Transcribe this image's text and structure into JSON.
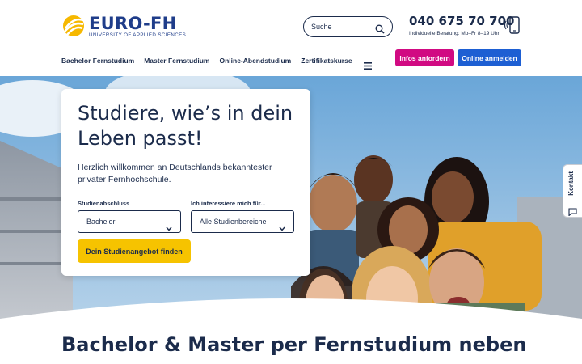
{
  "brand": {
    "name": "EURO-FH",
    "subtitle": "UNIVERSITY OF APPLIED SCIENCES",
    "color_primary": "#1f3d8a",
    "color_logo_mark": "#f6b800"
  },
  "search": {
    "placeholder": "Suche",
    "icon": "search-icon"
  },
  "contact": {
    "phone": "040 675 70 700",
    "note": "Individuelle Beratung: Mo–Fr 8–19 Uhr",
    "icon": "mobile-phone-icon"
  },
  "nav": {
    "items": [
      {
        "label": "Bachelor Fernstudium"
      },
      {
        "label": "Master Fernstudium"
      },
      {
        "label": "Online-Abendstudium"
      },
      {
        "label": "Zertifikatskurse"
      }
    ],
    "menu_icon": "hamburger-menu-icon"
  },
  "actions": {
    "info_label": "Infos anfordern",
    "info_color": "#d10a82",
    "apply_label": "Online anmelden",
    "apply_color": "#1d5fd3"
  },
  "hero": {
    "title": "Studiere, wie’s in dein Leben passt!",
    "text": "Herzlich willkommen an Deutschlands bekanntester privater Fernhochschule.",
    "degree_label": "Studienabschluss",
    "degree_value": "Bachelor",
    "interest_label": "Ich interessiere mich für...",
    "interest_value": "Alle Studienbereiche",
    "cta_label": "Dein Studienangebot finden",
    "cta_color": "#f6c300"
  },
  "side_tab": {
    "label": "Kontakt",
    "icon": "chat-icon"
  },
  "section": {
    "title": "Bachelor & Master per Fernstudium neben"
  }
}
